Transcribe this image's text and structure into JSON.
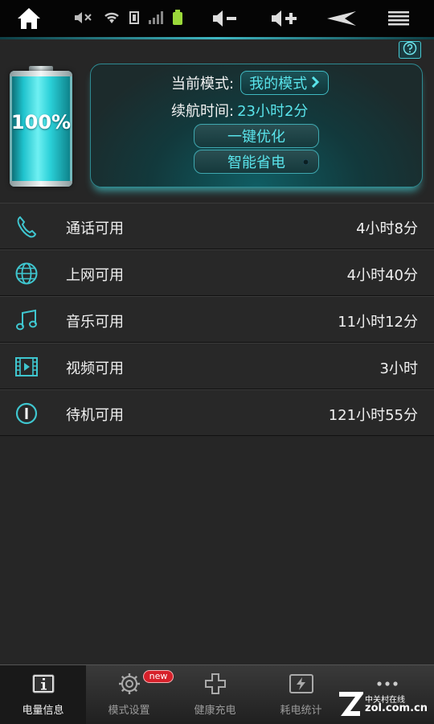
{
  "status_bar": {
    "icons": [
      "home-icon",
      "mute-icon",
      "wifi-icon",
      "sim-icon",
      "signal-icon",
      "battery-icon",
      "volume-down-icon",
      "volume-up-icon",
      "back-icon",
      "menu-icon"
    ]
  },
  "battery": {
    "level_percent": 100,
    "label": "100%"
  },
  "mode_panel": {
    "current_mode_label": "当前模式:",
    "current_mode_value": "我的模式",
    "endurance_label": "续航时间:",
    "endurance_value": "23小时2分",
    "optimize_button": "一键优化",
    "smart_save_button": "智能省电"
  },
  "usage": [
    {
      "icon": "phone-icon",
      "name": "通话可用",
      "time": "4小时8分"
    },
    {
      "icon": "globe-icon",
      "name": "上网可用",
      "time": "4小时40分"
    },
    {
      "icon": "music-icon",
      "name": "音乐可用",
      "time": "11小时12分"
    },
    {
      "icon": "video-icon",
      "name": "视频可用",
      "time": "3小时"
    },
    {
      "icon": "power-icon",
      "name": "待机可用",
      "time": "121小时55分"
    }
  ],
  "tabs": [
    {
      "icon": "info-icon",
      "label": "电量信息",
      "active": true
    },
    {
      "icon": "gear-icon",
      "label": "模式设置",
      "badge": "new"
    },
    {
      "icon": "plus-icon",
      "label": "健康充电"
    },
    {
      "icon": "bolt-icon",
      "label": "耗电统计"
    },
    {
      "icon": "more-icon",
      "label": ""
    }
  ],
  "watermark": {
    "line1": "中关村在线",
    "line2": "zol.com.cn"
  },
  "colors": {
    "accent": "#59e3ea",
    "background": "#262626",
    "badge": "#d6202a"
  }
}
